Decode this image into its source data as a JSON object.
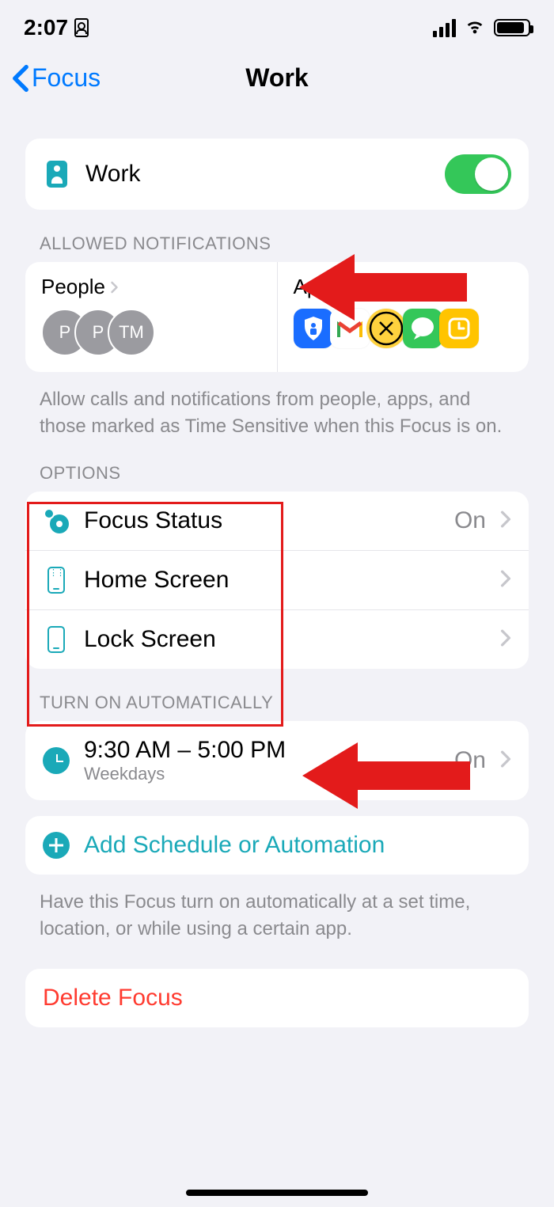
{
  "statusbar": {
    "time": "2:07"
  },
  "nav": {
    "back": "Focus",
    "title": "Work"
  },
  "focus": {
    "name": "Work",
    "enabled": true
  },
  "allowed": {
    "header": "ALLOWED NOTIFICATIONS",
    "people_label": "People",
    "apps_label": "Apps",
    "people": [
      "P",
      "P",
      "TM"
    ],
    "footer": "Allow calls and notifications from people, apps, and those marked as Time Sensitive when this Focus is on."
  },
  "options": {
    "header": "OPTIONS",
    "items": [
      {
        "label": "Focus Status",
        "value": "On"
      },
      {
        "label": "Home Screen",
        "value": ""
      },
      {
        "label": "Lock Screen",
        "value": ""
      }
    ]
  },
  "auto": {
    "header": "TURN ON AUTOMATICALLY",
    "schedule_time": "9:30 AM – 5:00 PM",
    "schedule_days": "Weekdays",
    "schedule_state": "On",
    "add_label": "Add Schedule or Automation",
    "footer": "Have this Focus turn on automatically at a set time, location, or while using a certain app."
  },
  "delete": {
    "label": "Delete Focus"
  }
}
